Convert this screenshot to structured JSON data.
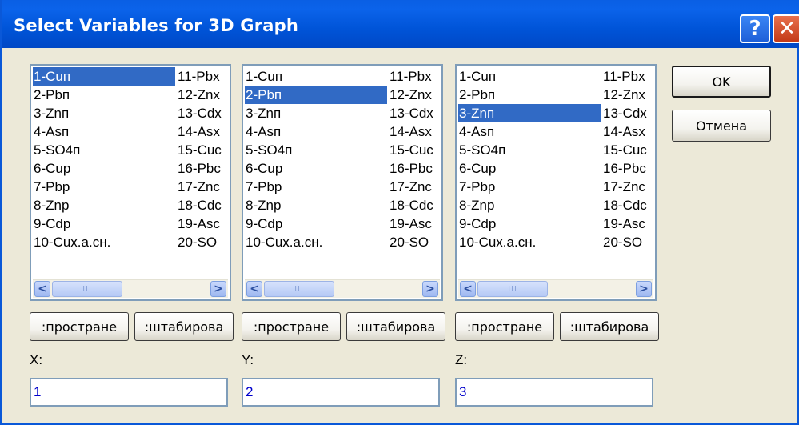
{
  "window": {
    "title": "Select Variables for 3D Graph",
    "help_symbol": "?",
    "close_symbol": "✕"
  },
  "variables": [
    "1-Cuп",
    "2-Pbп",
    "3-Znп",
    "4-Asп",
    "5-SO4п",
    "6-Cup",
    "7-Pbp",
    "8-Znp",
    "9-Cdp",
    "10-Cux.a.cн.",
    "11-Pbx",
    "12-Znx",
    "13-Cdx",
    "14-Asx",
    "15-Cuc",
    "16-Pbc",
    "17-Znc",
    "18-Cdc",
    "19-Asc",
    "20-SO"
  ],
  "lists": [
    {
      "axis": "X",
      "selected_index": 0,
      "value": "1"
    },
    {
      "axis": "Y",
      "selected_index": 1,
      "value": "2"
    },
    {
      "axis": "Z",
      "selected_index": 2,
      "value": "3"
    }
  ],
  "panel_buttons": {
    "first_label": ":пространe",
    "second_label": ":штабирова"
  },
  "axis_labels": {
    "x": "X:",
    "y": "Y:",
    "z": "Z:"
  },
  "inputs": {
    "x": "1",
    "y": "2",
    "z": "3"
  },
  "side_buttons": {
    "ok": "OK",
    "cancel": "Отмена"
  },
  "scrollbar": {
    "left_arrow": "<",
    "right_arrow": ">",
    "thumb_grip": "III"
  },
  "colors": {
    "titlebar": "#0054d8",
    "selection": "#316ac5",
    "dialog_bg": "#ece9d8",
    "input_text": "#0000cc"
  }
}
